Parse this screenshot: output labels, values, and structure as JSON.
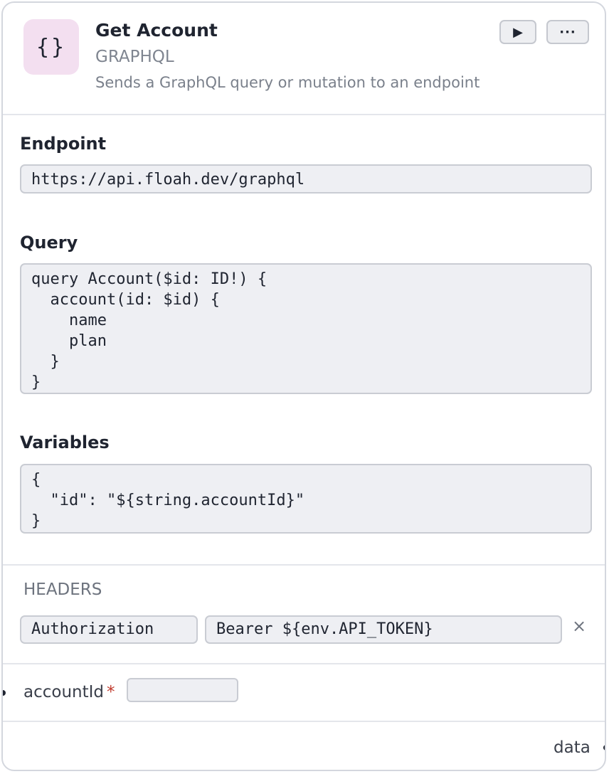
{
  "node": {
    "icon": "braces-icon",
    "icon_text": "{}",
    "title": "Get Account",
    "type": "GRAPHQL",
    "description": "Sends a GraphQL query or mutation to an endpoint",
    "accent_color": "#f3dff0"
  },
  "toolbar": {
    "run_icon": "play-icon",
    "run_label": "▶",
    "more_icon": "ellipsis-icon",
    "more_label": "···"
  },
  "endpoint": {
    "label": "Endpoint",
    "value": "https://api.floah.dev/graphql"
  },
  "query": {
    "label": "Query",
    "value": "query Account($id: ID!) {\n  account(id: $id) {\n    name\n    plan\n  }\n}"
  },
  "variables": {
    "label": "Variables",
    "value": "{\n  \"id\": \"${string.accountId}\"\n}"
  },
  "headers": {
    "title": "HEADERS",
    "rows": [
      {
        "key": "Authorization",
        "value": "Bearer ${env.API_TOKEN}",
        "remove_label": "×"
      }
    ]
  },
  "inputs": [
    {
      "name": "accountId",
      "required_marker": "*",
      "value": ""
    }
  ],
  "outputs": [
    {
      "name": "data"
    }
  ]
}
